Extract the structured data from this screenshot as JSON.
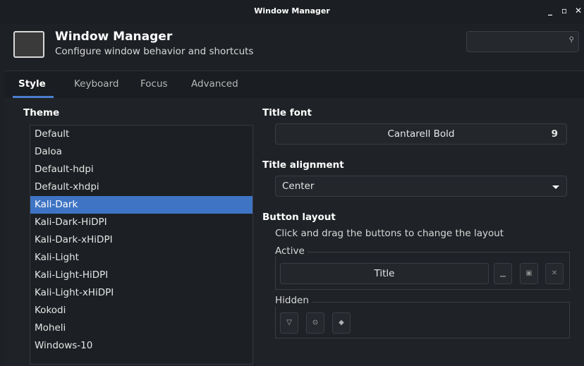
{
  "window": {
    "title": "Window Manager",
    "minimize_glyph": "_",
    "maximize_glyph": "▫",
    "close_glyph": "✕"
  },
  "header": {
    "icon": "window-icon",
    "title": "Window Manager",
    "subtitle": "Configure window behavior and shortcuts",
    "search_icon": "search-icon"
  },
  "tabs": [
    {
      "label": "Style",
      "active": true
    },
    {
      "label": "Keyboard",
      "active": false
    },
    {
      "label": "Focus",
      "active": false
    },
    {
      "label": "Advanced",
      "active": false
    }
  ],
  "theme": {
    "label": "Theme",
    "items": [
      "Default",
      "Daloa",
      "Default-hdpi",
      "Default-xhdpi",
      "Kali-Dark",
      "Kali-Dark-HiDPI",
      "Kali-Dark-xHiDPI",
      "Kali-Light",
      "Kali-Light-HiDPI",
      "Kali-Light-xHiDPI",
      "Kokodi",
      "Moheli",
      "Windows-10"
    ],
    "selected": "Kali-Dark"
  },
  "title_font": {
    "label": "Title font",
    "name": "Cantarell Bold",
    "size": "9"
  },
  "title_alignment": {
    "label": "Title alignment",
    "value": "Center"
  },
  "button_layout": {
    "label": "Button layout",
    "hint": "Click and drag the buttons to change the layout",
    "active_label": "Active",
    "title_button": "Title",
    "active_buttons": [
      {
        "icon": "minimize-icon",
        "glyph": "▁"
      },
      {
        "icon": "maximize-icon",
        "glyph": "▣"
      },
      {
        "icon": "close-icon",
        "glyph": "✕"
      }
    ],
    "hidden_label": "Hidden",
    "hidden_buttons": [
      {
        "icon": "shade-icon",
        "glyph": "▽"
      },
      {
        "icon": "stick-icon",
        "glyph": "⊙"
      },
      {
        "icon": "menu-icon",
        "glyph": "◆"
      }
    ]
  },
  "colors": {
    "accent": "#3f74c4",
    "background": "#1d2024"
  }
}
